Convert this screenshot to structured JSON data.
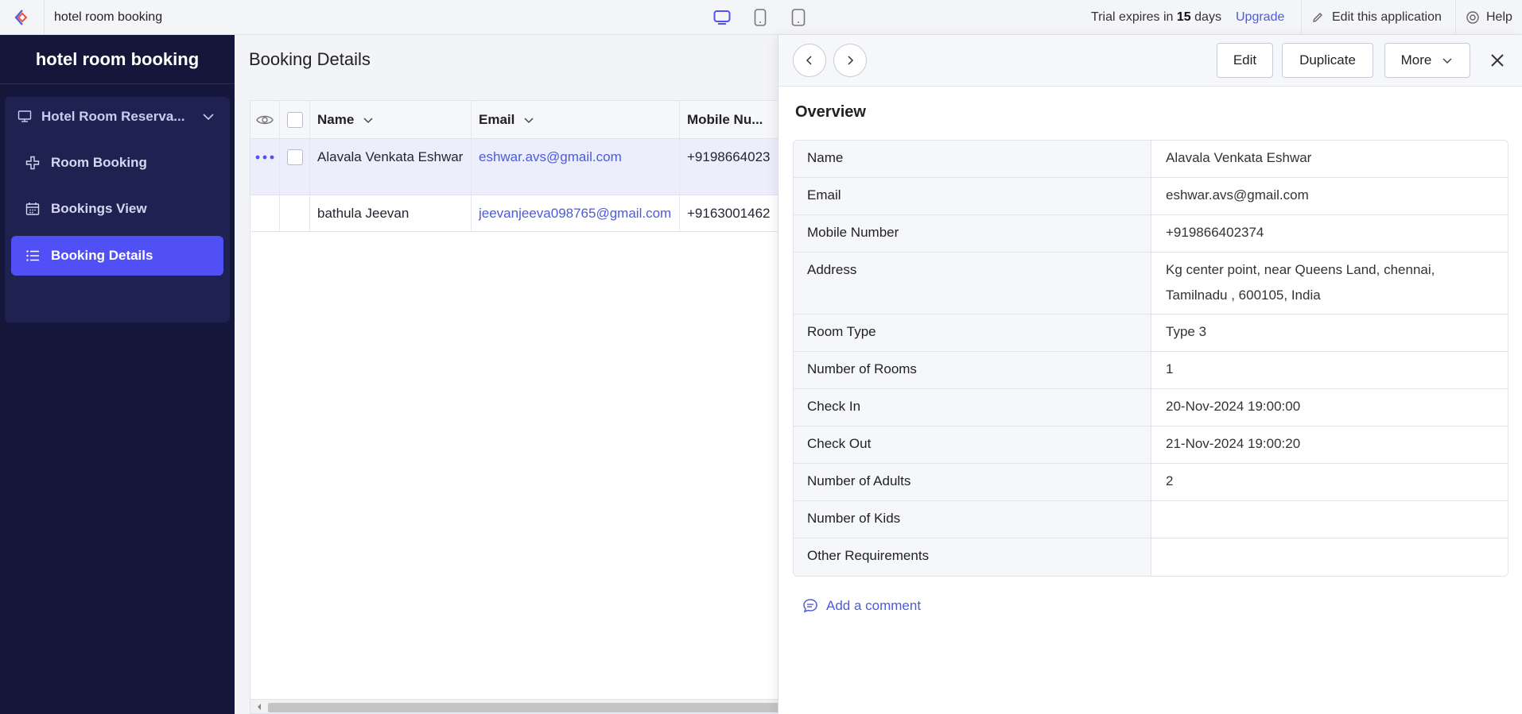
{
  "topbar": {
    "app_name": "hotel room booking",
    "trial_prefix": "Trial expires in",
    "trial_days": "15",
    "trial_suffix": "days",
    "upgrade": "Upgrade",
    "edit_app": "Edit this application",
    "help": "Help",
    "accent": "#5050f6"
  },
  "sidebar": {
    "title": "hotel room booking",
    "group_label": "Hotel Room Reserva...",
    "items": [
      {
        "label": "Room Booking",
        "icon": "plus-cross-icon"
      },
      {
        "label": "Bookings View",
        "icon": "calendar-icon"
      },
      {
        "label": "Booking Details",
        "icon": "list-icon",
        "active": true
      }
    ]
  },
  "main": {
    "title": "Booking Details",
    "columns": [
      "Name",
      "Email",
      "Mobile Nu..."
    ],
    "rows": [
      {
        "name": "Alavala Venkata Eshwar",
        "email": "eshwar.avs@gmail.com",
        "mobile": "+9198664023"
      },
      {
        "name": "bathula Jeevan",
        "email": "jeevanjeeva098765@gmail.com",
        "mobile": "+9163001462"
      }
    ]
  },
  "panel": {
    "edit": "Edit",
    "duplicate": "Duplicate",
    "more": "More",
    "overview_title": "Overview",
    "fields": [
      {
        "label": "Name",
        "value": "Alavala Venkata Eshwar"
      },
      {
        "label": "Email",
        "value": "eshwar.avs@gmail.com"
      },
      {
        "label": "Mobile Number",
        "value": "+919866402374"
      },
      {
        "label": "Address",
        "value": "Kg center point, near Queens Land, chennai, Tamilnadu , 600105, India"
      },
      {
        "label": "Room Type",
        "value": "Type 3"
      },
      {
        "label": "Number of Rooms",
        "value": "1"
      },
      {
        "label": "Check In",
        "value": "20-Nov-2024 19:00:00"
      },
      {
        "label": "Check Out",
        "value": "21-Nov-2024 19:00:20"
      },
      {
        "label": "Number of Adults",
        "value": "2"
      },
      {
        "label": "Number of Kids",
        "value": ""
      },
      {
        "label": "Other Requirements",
        "value": ""
      }
    ],
    "add_comment": "Add a comment"
  }
}
